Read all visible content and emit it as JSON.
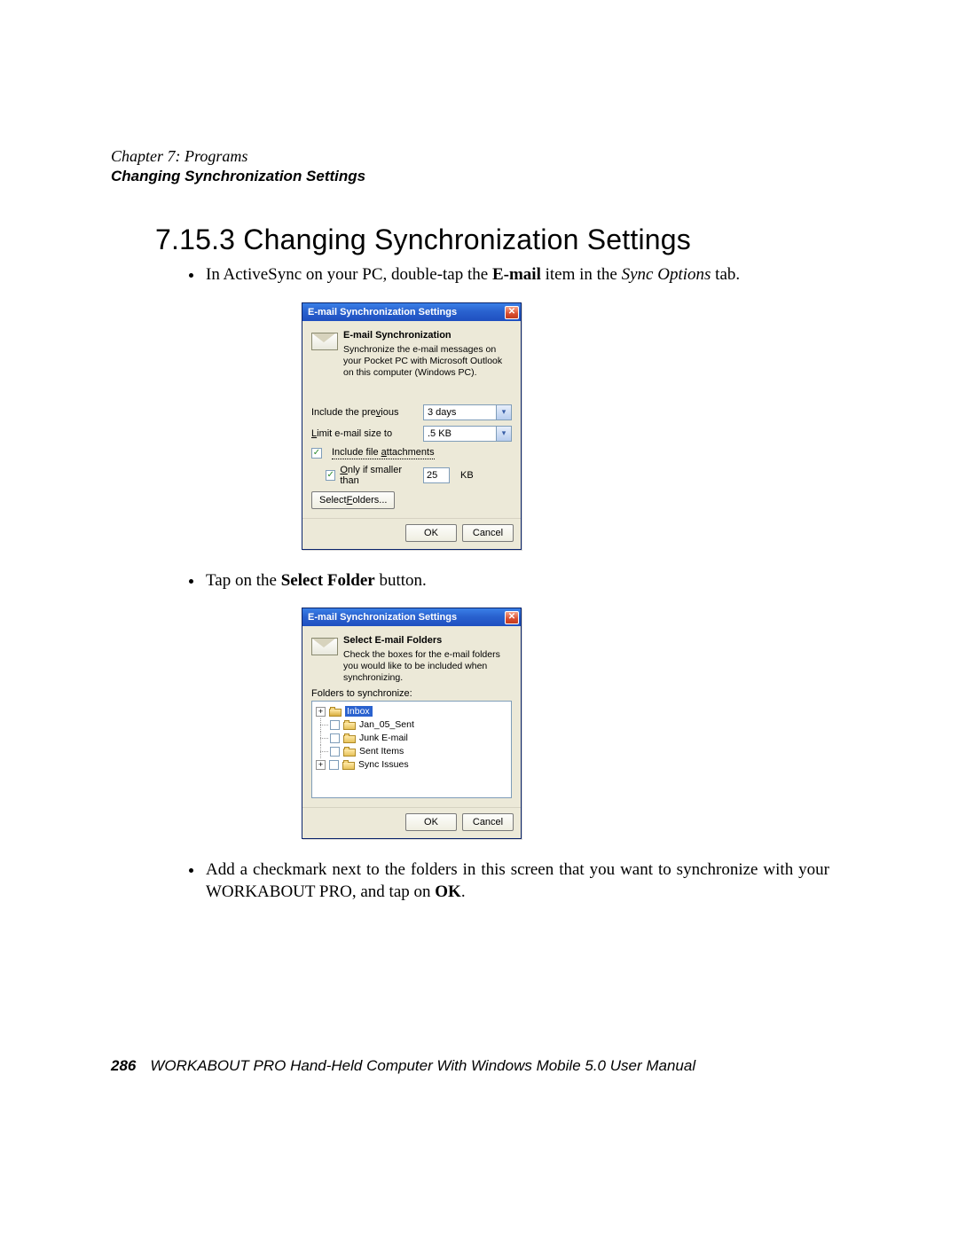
{
  "header": {
    "chapter_line": "Chapter 7:  Programs",
    "section_line": "Changing Synchronization Settings"
  },
  "heading": {
    "number": "7.15.3",
    "title": "Changing Synchronization Settings"
  },
  "bullets": {
    "b1_pre": "In ActiveSync on your PC, double-tap the ",
    "b1_bold1": "E-mail",
    "b1_mid": " item in the ",
    "b1_ital": "Sync Options",
    "b1_post": " tab.",
    "b2_pre": "Tap on the ",
    "b2_bold": "Select Folder",
    "b2_post": " button.",
    "b3_pre": "Add a checkmark next to the folders in this screen that you want to synchronize with your WORKABOUT PRO, and tap on ",
    "b3_bold": "OK",
    "b3_post": "."
  },
  "dialog1": {
    "title": "E-mail Synchronization Settings",
    "heading": "E-mail Synchronization",
    "desc": "Synchronize the e-mail messages on your Pocket PC with Microsoft Outlook on this computer (Windows PC).",
    "row1_label_pre": "Include the pre",
    "row1_label_u": "v",
    "row1_label_post": "ious",
    "row1_value": "3 days",
    "row2_label_u": "L",
    "row2_label_post": "imit e-mail size to",
    "row2_value": ".5 KB",
    "chk1_label_pre": "Include file ",
    "chk1_label_u": "a",
    "chk1_label_post": "ttachments",
    "chk2_label_u": "O",
    "chk2_label_post": "nly if smaller than",
    "size_value": "25",
    "size_unit": "KB",
    "select_folders_btn_pre": "Select ",
    "select_folders_btn_u": "F",
    "select_folders_btn_post": "olders...",
    "ok": "OK",
    "cancel": "Cancel"
  },
  "dialog2": {
    "title": "E-mail Synchronization Settings",
    "heading": "Select E-mail Folders",
    "desc": "Check the boxes for the e-mail folders you would like to be included when synchronizing.",
    "tree_label": "Folders to synchronize:",
    "nodes": {
      "inbox": "Inbox",
      "jan": "Jan_05_Sent",
      "junk": "Junk E-mail",
      "sent": "Sent Items",
      "sync": "Sync Issues"
    },
    "ok": "OK",
    "cancel": "Cancel"
  },
  "footer": {
    "page_number": "286",
    "text": "WORKABOUT PRO Hand-Held Computer With Windows Mobile 5.0 User Manual"
  }
}
